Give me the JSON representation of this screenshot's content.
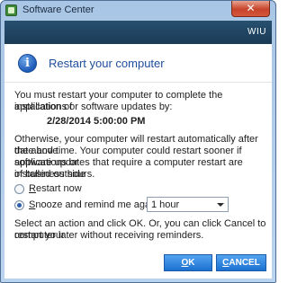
{
  "window": {
    "title": "Software Center",
    "close_glyph": "✕",
    "brand": "WIU"
  },
  "banner": {
    "icon": "info-icon",
    "icon_glyph": "i",
    "title": "Restart your computer"
  },
  "message": {
    "line1": "You must restart your computer to complete the installation of",
    "line2": "applications or software updates by:",
    "deadline": "2/28/2014 5:00:00 PM",
    "p2_line1": "Otherwise, your computer will restart automatically after the above",
    "p2_line2": "date and time.  Your computer could restart sooner if applications or",
    "p2_line3": "software updates that require a computer restart are installed outside",
    "p2_line4": "of business hours."
  },
  "options": {
    "restart_now": {
      "mnemonic": "R",
      "rest": "estart now",
      "checked": false
    },
    "snooze": {
      "mnemonic": "S",
      "rest": "nooze and remind me again in:",
      "checked": true
    },
    "snooze_value": "1 hour"
  },
  "footer": {
    "line1": "Select an action and click OK.  Or, you can click Cancel to restart your",
    "line2": "computer later without receiving reminders."
  },
  "buttons": {
    "ok_mnemonic": "O",
    "ok_rest": "K",
    "cancel_mnemonic": "C",
    "cancel_rest": "ANCEL"
  },
  "colors": {
    "accent": "#1f4e9e",
    "button": "#1c70d0",
    "header": "#1a3a56"
  }
}
